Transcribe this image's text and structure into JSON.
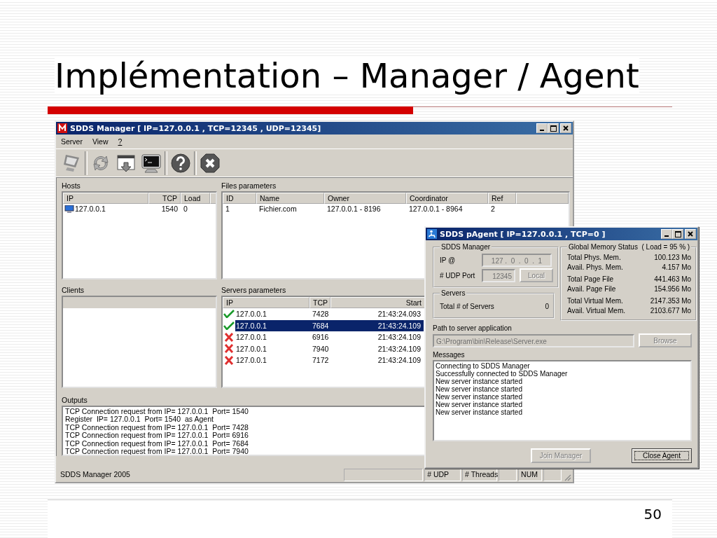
{
  "slide": {
    "title": "Implémentation – Manager / Agent",
    "page_number": "50"
  },
  "manager": {
    "title": "SDDS Manager [ IP=127.0.0.1 , TCP=12345 , UDP=12345]",
    "menu": [
      {
        "label": "Server",
        "underlined": false
      },
      {
        "label": "View",
        "underlined": false
      },
      {
        "label": "?",
        "underlined": true
      }
    ],
    "hosts": {
      "label": "Hosts",
      "columns": [
        "IP",
        "TCP",
        "Load"
      ],
      "rows": [
        {
          "ip": "127.0.0.1",
          "tcp": "1540",
          "load": "0"
        }
      ]
    },
    "files": {
      "label": "Files parameters",
      "columns": [
        "ID",
        "Name",
        "Owner",
        "Coordinator",
        "Ref"
      ],
      "rows": [
        {
          "cells": [
            "1",
            "Fichier.com",
            "127.0.0.1 - 8196",
            "127.0.0.1 - 8964",
            "2"
          ]
        }
      ]
    },
    "clients": {
      "label": "Clients"
    },
    "servers": {
      "label": "Servers parameters",
      "columns": [
        "IP",
        "TCP",
        "Start"
      ],
      "rows": [
        {
          "kind": "ok",
          "ip": "127.0.0.1",
          "tcp": "7428",
          "start": "21:43:24.093",
          "selected": false
        },
        {
          "kind": "ok",
          "ip": "127.0.0.1",
          "tcp": "7684",
          "start": "21:43:24.109",
          "selected": true
        },
        {
          "kind": "failed",
          "ip": "127.0.0.1",
          "tcp": "6916",
          "start": "21:43:24.109",
          "selected": false
        },
        {
          "kind": "failed",
          "ip": "127.0.0.1",
          "tcp": "7940",
          "start": "21:43:24.109",
          "selected": false
        },
        {
          "kind": "failed",
          "ip": "127.0.0.1",
          "tcp": "7172",
          "start": "21:43:24.109",
          "selected": false
        }
      ]
    },
    "outputs": {
      "label": "Outputs",
      "lines": [
        "TCP Connection request from IP= 127.0.0.1  Port= 1540",
        "Register  IP= 127.0.0.1  Port= 1540  as Agent",
        "TCP Connection request from IP= 127.0.0.1  Port= 7428",
        "TCP Connection request from IP= 127.0.0.1  Port= 6916",
        "TCP Connection request from IP= 127.0.0.1  Port= 7684",
        "TCP Connection request from IP= 127.0.0.1  Port= 7940"
      ]
    },
    "status_bar": {
      "app": "SDDS Manager 2005",
      "udp": "# UDP",
      "threads": "# Threads",
      "num": "NUM"
    }
  },
  "agent": {
    "title": "SDDS pAgent [ IP=127.0.0.1 , TCP=0 ]",
    "manager_group": {
      "label": "SDDS Manager",
      "ip_label": "IP @",
      "ip_field": {
        "value": "127 .  0  .  0  .  1",
        "disabled": true
      },
      "port_label": "# UDP Port",
      "port_field": {
        "value": "12345",
        "disabled": true
      },
      "local_button": {
        "label": "Local",
        "disabled": true
      }
    },
    "servers_group": {
      "label": "Servers",
      "total_label": "Total # of Servers",
      "total": "0"
    },
    "memory_group": {
      "label": "Global Memory Status  ( Load = 95 % )",
      "sections": [
        {
          "rows": [
            {
              "label": "Total Phys. Mem.",
              "value": "100.123 Mo"
            },
            {
              "label": "Avail. Phys. Mem.",
              "value": "4.157 Mo"
            }
          ]
        },
        {
          "rows": [
            {
              "label": "Total Page File",
              "value": "441.463 Mo"
            },
            {
              "label": "Avail. Page File",
              "value": "154.956 Mo"
            }
          ]
        },
        {
          "rows": [
            {
              "label": "Total Virtual Mem.",
              "value": "2147.353 Mo"
            },
            {
              "label": "Avail. Virtual Mem.",
              "value": "2103.677 Mo"
            }
          ]
        }
      ]
    },
    "path_label": "Path to server application",
    "path_field": {
      "value": "G:\\Program\\bin\\Release\\Server.exe",
      "disabled": true
    },
    "browse_button": {
      "label": "Browse",
      "disabled": true
    },
    "messages_label": "Messages",
    "messages": [
      "Connecting to SDDS Manager",
      "Successfully connected to SDDS Manager",
      "New server instance started",
      "New server instance started",
      "New server instance started",
      "New server instance started",
      "New server instance started"
    ],
    "join_button": {
      "label": "Join Manager",
      "disabled": true,
      "focused": false
    },
    "close_button": {
      "label": "Close Agent",
      "disabled": false,
      "focused": true
    }
  }
}
